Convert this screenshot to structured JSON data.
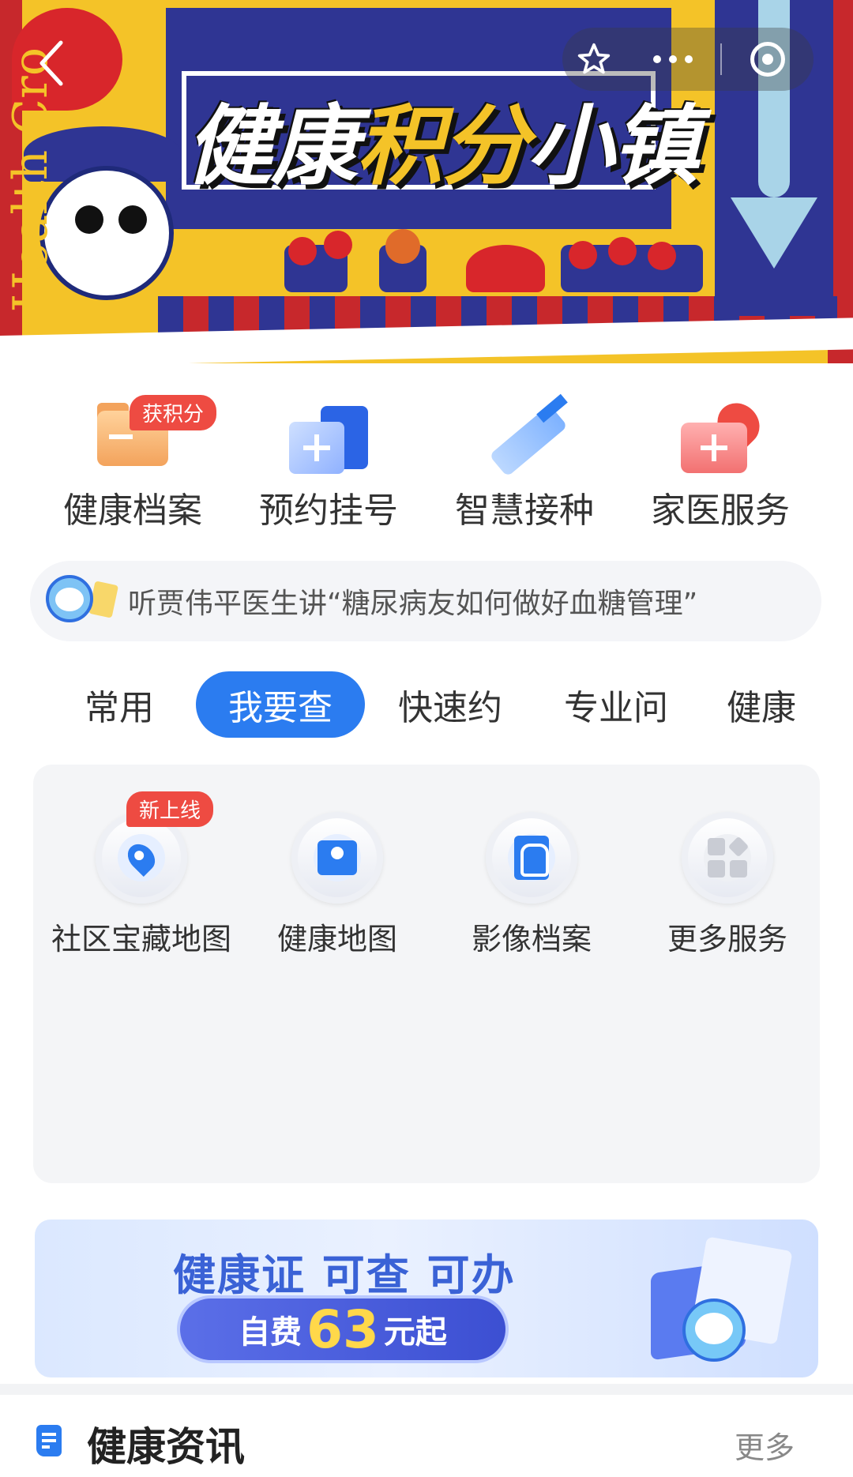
{
  "banner": {
    "title_part1": "健康",
    "title_part2": "积分",
    "title_part3": "小镇",
    "side_text": "Health Cro"
  },
  "nav": {
    "back_icon": "chevron-left-icon",
    "star_icon": "star-icon",
    "more_icon": "more-dots-icon",
    "close_icon": "target-close-icon"
  },
  "quick_services": [
    {
      "label": "健康档案",
      "badge": "获积分",
      "icon": "folder-icon"
    },
    {
      "label": "预约挂号",
      "badge": "",
      "icon": "add-card-icon"
    },
    {
      "label": "智慧接种",
      "badge": "",
      "icon": "syringe-icon"
    },
    {
      "label": "家医服务",
      "badge": "",
      "icon": "medical-kit-heart-icon"
    }
  ],
  "notice": {
    "text": "听贾伟平医生讲“糖尿病友如何做好血糖管理”"
  },
  "tabs": [
    {
      "label": "常用",
      "active": false
    },
    {
      "label": "我要查",
      "active": true
    },
    {
      "label": "快速约",
      "active": false
    },
    {
      "label": "专业问",
      "active": false
    },
    {
      "label": "健康",
      "active": false
    }
  ],
  "services": [
    {
      "label": "社区宝藏地图",
      "badge": "新上线",
      "icon": "location-pin-icon"
    },
    {
      "label": "健康地图",
      "badge": "",
      "icon": "map-icon"
    },
    {
      "label": "影像档案",
      "badge": "",
      "icon": "lung-image-icon"
    },
    {
      "label": "更多服务",
      "badge": "",
      "icon": "grid-more-icon"
    }
  ],
  "promo": {
    "title": "健康证 可查 可办",
    "prefix": "自费",
    "price": "63",
    "suffix": "元起"
  },
  "news": {
    "title": "健康资讯",
    "more": "更多"
  },
  "colors": {
    "accent": "#2b7cf0",
    "badge_red": "#ee4b42",
    "banner_blue": "#2f3593",
    "banner_yellow": "#f4c328",
    "banner_red": "#c7282c"
  }
}
